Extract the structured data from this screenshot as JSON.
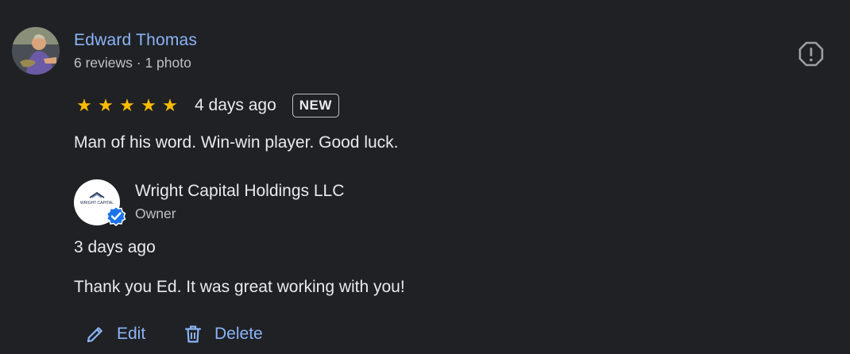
{
  "reviewer": {
    "name": "Edward Thomas",
    "meta": "6 reviews · 1 photo"
  },
  "review": {
    "rating": 5,
    "stars": [
      "★",
      "★",
      "★",
      "★",
      "★"
    ],
    "time": "4 days ago",
    "badge": "NEW",
    "text": "Man of his word. Win-win player. Good luck."
  },
  "owner": {
    "name": "Wright Capital Holdings LLC",
    "role": "Owner",
    "logo_text": "WRIGHT CAPITAL",
    "reply_time": "3 days ago",
    "reply_text": "Thank you Ed. It was great working with you!"
  },
  "actions": {
    "edit_label": "Edit",
    "delete_label": "Delete"
  },
  "colors": {
    "background": "#202124",
    "link": "#8ab4f8",
    "star": "#fbbc04",
    "verified": "#1a73e8"
  },
  "icons": {
    "report": "report-icon",
    "edit": "pencil-icon",
    "delete": "trash-icon",
    "verified": "verified-check-icon"
  }
}
